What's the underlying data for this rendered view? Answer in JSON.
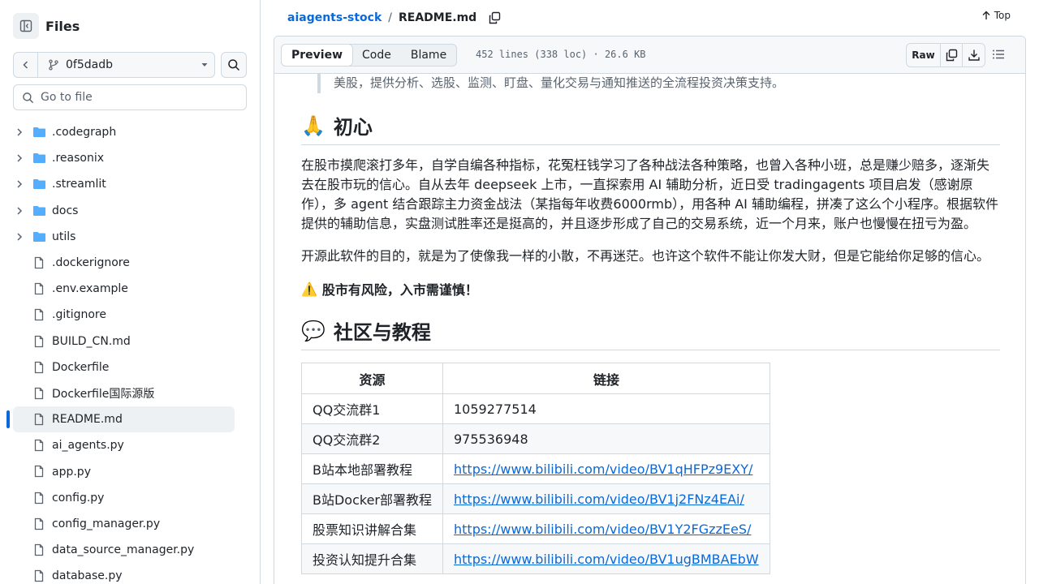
{
  "sidebar": {
    "title": "Files",
    "branch": "0f5dadb",
    "search_placeholder": "Go to file",
    "tree": [
      {
        "name": ".codegraph",
        "type": "folder"
      },
      {
        "name": ".reasonix",
        "type": "folder"
      },
      {
        "name": ".streamlit",
        "type": "folder"
      },
      {
        "name": "docs",
        "type": "folder"
      },
      {
        "name": "utils",
        "type": "folder"
      },
      {
        "name": ".dockerignore",
        "type": "file"
      },
      {
        "name": ".env.example",
        "type": "file"
      },
      {
        "name": ".gitignore",
        "type": "file"
      },
      {
        "name": "BUILD_CN.md",
        "type": "file"
      },
      {
        "name": "Dockerfile",
        "type": "file"
      },
      {
        "name": "Dockerfile国际源版",
        "type": "file"
      },
      {
        "name": "README.md",
        "type": "file",
        "active": true
      },
      {
        "name": "ai_agents.py",
        "type": "file"
      },
      {
        "name": "app.py",
        "type": "file"
      },
      {
        "name": "config.py",
        "type": "file"
      },
      {
        "name": "config_manager.py",
        "type": "file"
      },
      {
        "name": "data_source_manager.py",
        "type": "file"
      },
      {
        "name": "database.py",
        "type": "file"
      }
    ]
  },
  "breadcrumb": {
    "repo": "aiagents-stock",
    "separator": "/",
    "file": "README.md"
  },
  "top_label": "Top",
  "view_tabs": {
    "preview": "Preview",
    "code": "Code",
    "blame": "Blame"
  },
  "file_info": "452 lines (338 loc) · 26.6 KB",
  "raw_label": "Raw",
  "readme": {
    "quote": "美股，提供分析、选股、监测、盯盘、量化交易与通知推送的全流程投资决策支持。",
    "h_origin": "初心",
    "h_origin_emoji": "🙏",
    "para1": "在股市摸爬滚打多年，自学自编各种指标，花冤枉钱学习了各种战法各种策略，也曾入各种小班，总是赚少赔多，逐渐失去在股市玩的信心。自从去年 deepseek 上市，一直探索用 AI 辅助分析，近日受 tradingagents 项目启发（感谢原作），多 agent 结合跟踪主力资金战法（某指每年收费6000rmb），用各种 AI 辅助编程，拼凑了这么个小程序。根据软件提供的辅助信息，实盘测试胜率还是挺高的，并且逐步形成了自己的交易系统，近一个月来，账户也慢慢在扭亏为盈。",
    "para2": "开源此软件的目的，就是为了使像我一样的小散，不再迷茫。也许这个软件不能让你发大财，但是它能给你足够的信心。",
    "warning_emoji": "⚠️",
    "warning": "股市有风险，入市需谨慎！",
    "h_community": "社区与教程",
    "h_community_emoji": "💬",
    "table": {
      "headers": [
        "资源",
        "链接"
      ],
      "rows": [
        {
          "name": "QQ交流群1",
          "value": "1059277514",
          "link": false
        },
        {
          "name": "QQ交流群2",
          "value": "975536948",
          "link": false
        },
        {
          "name": "B站本地部署教程",
          "value": "https://www.bilibili.com/video/BV1qHFPz9EXY/",
          "link": true
        },
        {
          "name": "B站Docker部署教程",
          "value": "https://www.bilibili.com/video/BV1j2FNz4EAi/",
          "link": true
        },
        {
          "name": "股票知识讲解合集",
          "value": "https://www.bilibili.com/video/BV1Y2FGzzEeS/",
          "link": true
        },
        {
          "name": "投资认知提升合集",
          "value": "https://www.bilibili.com/video/BV1ugBMBAEbW",
          "link": true
        }
      ]
    }
  }
}
